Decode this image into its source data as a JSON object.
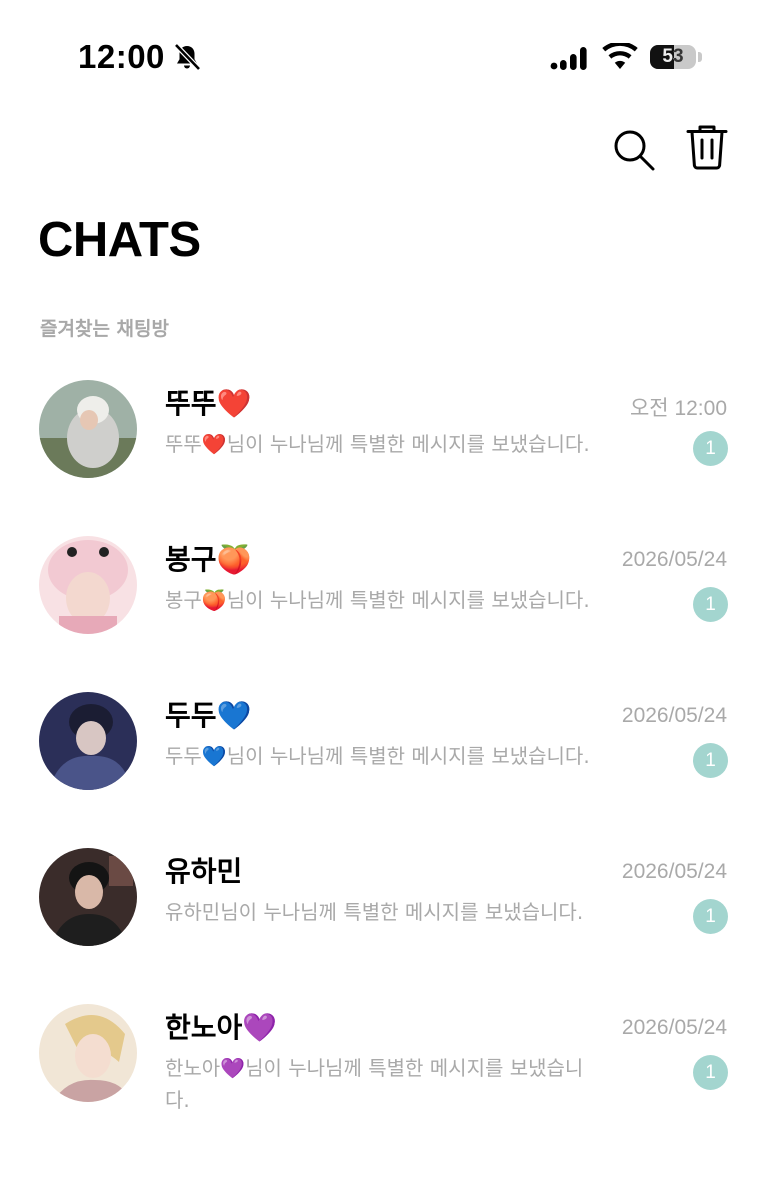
{
  "status_bar": {
    "time": "12:00",
    "battery": "53",
    "battery_level": 0.53,
    "icons": [
      "bell-off-icon",
      "cellular-signal-icon",
      "wifi-icon",
      "battery-icon"
    ]
  },
  "header": {
    "title": "CHATS",
    "actions": [
      "search-icon",
      "trash-icon"
    ]
  },
  "favorites_label": "즐겨찾는 채팅방",
  "chats": [
    {
      "name": "뚜뚜❤️",
      "preview": "뚜뚜❤️님이 누나님께 특별한 메시지를 보냈습니다.",
      "time": "오전 12:00",
      "unread": "1",
      "avatar_colors": [
        "#9fb1a6",
        "#cfcfcc",
        "#6b7a5a"
      ]
    },
    {
      "name": "봉구🍑",
      "preview": "봉구🍑님이 누나님께 특별한 메시지를 보냈습니다.",
      "time": "2026/05/24",
      "unread": "1",
      "avatar_colors": [
        "#f2c9d2",
        "#e7a9b8",
        "#f8e1e4"
      ]
    },
    {
      "name": "두두💙",
      "preview": "두두💙님이 누나님께 특별한 메시지를 보냈습니다.",
      "time": "2026/05/24",
      "unread": "1",
      "avatar_colors": [
        "#2b2f58",
        "#4a5489",
        "#d8c6c3"
      ]
    },
    {
      "name": "유하민",
      "preview": "유하민님이 누나님께 특별한 메시지를 보냈습니다.",
      "time": "2026/05/24",
      "unread": "1",
      "avatar_colors": [
        "#3a2c2a",
        "#6a4a44",
        "#d9b8a8"
      ]
    },
    {
      "name": "한노아💜",
      "preview": "한노아💜님이 누나님께 특별한 메시지를 보냈습니다.",
      "time": "2026/05/24",
      "unread": "1",
      "avatar_colors": [
        "#f1e6d6",
        "#e4c98c",
        "#c9a3a3"
      ]
    }
  ],
  "colors": {
    "badge": "#a3d5cf",
    "muted_text": "#a9a9a9"
  }
}
